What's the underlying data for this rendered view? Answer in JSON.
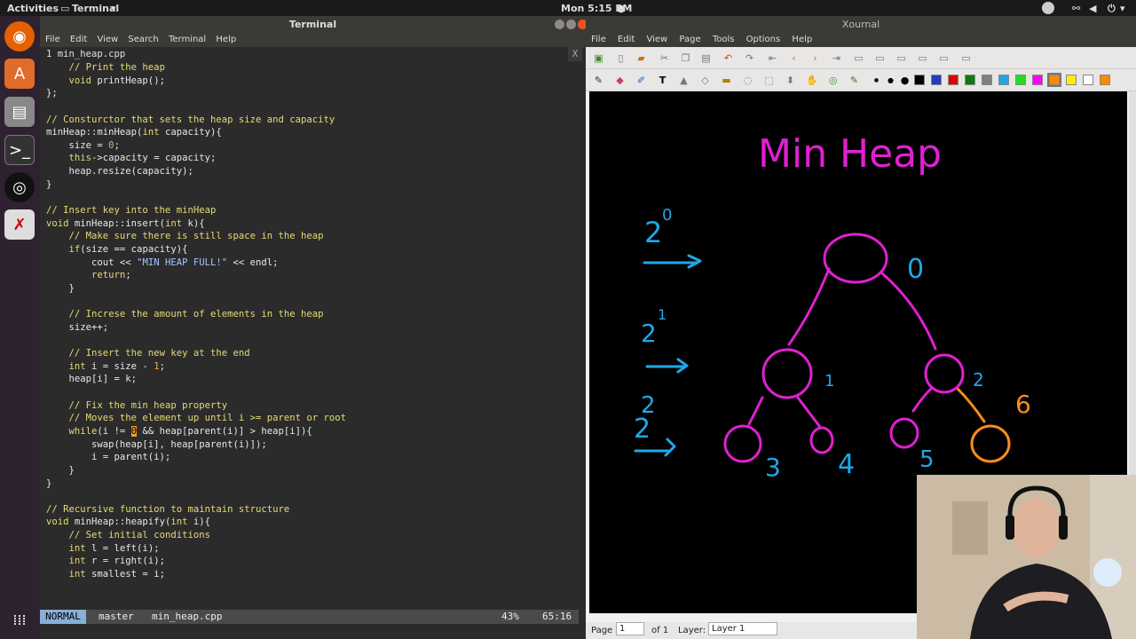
{
  "topbar": {
    "activities": "Activities",
    "app": "Terminal",
    "clock": "Mon  5:15 PM"
  },
  "terminal": {
    "title": "Terminal",
    "menu": [
      "File",
      "Edit",
      "View",
      "Search",
      "Terminal",
      "Help"
    ],
    "tab": "1 min_heap.cpp",
    "tab_close": "X",
    "code": [
      [
        {
          "t": "    "
        },
        {
          "t": "// Print the heap",
          "c": "cm"
        }
      ],
      [
        {
          "t": "    "
        },
        {
          "t": "void",
          "c": "kw"
        },
        {
          "t": " printHeap();"
        }
      ],
      [
        {
          "t": "};"
        }
      ],
      [
        {
          "t": ""
        }
      ],
      [
        {
          "t": "// Consturctor that sets the heap size and capacity",
          "c": "cm"
        }
      ],
      [
        {
          "t": "minHeap::minHeap("
        },
        {
          "t": "int",
          "c": "kw"
        },
        {
          "t": " capacity){"
        }
      ],
      [
        {
          "t": "    size = "
        },
        {
          "t": "0",
          "c": "num"
        },
        {
          "t": ";"
        }
      ],
      [
        {
          "t": "    "
        },
        {
          "t": "this",
          "c": "kw"
        },
        {
          "t": "->capacity = capacity;"
        }
      ],
      [
        {
          "t": "    heap.resize(capacity);"
        }
      ],
      [
        {
          "t": "}"
        }
      ],
      [
        {
          "t": ""
        }
      ],
      [
        {
          "t": "// Insert key into the minHeap",
          "c": "cm"
        }
      ],
      [
        {
          "t": "void",
          "c": "kw"
        },
        {
          "t": " minHeap::insert("
        },
        {
          "t": "int",
          "c": "kw"
        },
        {
          "t": " k){"
        }
      ],
      [
        {
          "t": "    "
        },
        {
          "t": "// Make sure there is still space in the heap",
          "c": "cm"
        }
      ],
      [
        {
          "t": "    "
        },
        {
          "t": "if",
          "c": "kw"
        },
        {
          "t": "(size == capacity){"
        }
      ],
      [
        {
          "t": "        cout << "
        },
        {
          "t": "\"MIN HEAP FULL!\"",
          "c": "str"
        },
        {
          "t": " << endl;"
        }
      ],
      [
        {
          "t": "        "
        },
        {
          "t": "return",
          "c": "kw"
        },
        {
          "t": ";"
        }
      ],
      [
        {
          "t": "    }"
        }
      ],
      [
        {
          "t": ""
        }
      ],
      [
        {
          "t": "    "
        },
        {
          "t": "// Increse the amount of elements in the heap",
          "c": "cm"
        }
      ],
      [
        {
          "t": "    size++;"
        }
      ],
      [
        {
          "t": ""
        }
      ],
      [
        {
          "t": "    "
        },
        {
          "t": "// Insert the new key at the end",
          "c": "cm"
        }
      ],
      [
        {
          "t": "    "
        },
        {
          "t": "int",
          "c": "kw"
        },
        {
          "t": " i = size - "
        },
        {
          "t": "1",
          "c": "num"
        },
        {
          "t": ";"
        }
      ],
      [
        {
          "t": "    heap[i] = k;"
        }
      ],
      [
        {
          "t": ""
        }
      ],
      [
        {
          "t": "    "
        },
        {
          "t": "// Fix the min heap property",
          "c": "cm"
        }
      ],
      [
        {
          "t": "    "
        },
        {
          "t": "// Moves the element up until i >= parent or root",
          "c": "cm"
        }
      ],
      [
        {
          "t": "    "
        },
        {
          "t": "while",
          "c": "kw"
        },
        {
          "t": "(i != "
        },
        {
          "t": "0",
          "c": "cursor"
        },
        {
          "t": " && heap[parent(i)] > heap[i]){"
        }
      ],
      [
        {
          "t": "        swap(heap[i], heap[parent(i)]);"
        }
      ],
      [
        {
          "t": "        i = parent(i);"
        }
      ],
      [
        {
          "t": "    }"
        }
      ],
      [
        {
          "t": "}"
        }
      ],
      [
        {
          "t": ""
        }
      ],
      [
        {
          "t": "// Recursive function to maintain structure",
          "c": "cm"
        }
      ],
      [
        {
          "t": "void",
          "c": "kw"
        },
        {
          "t": " minHeap::heapify("
        },
        {
          "t": "int",
          "c": "kw"
        },
        {
          "t": " i){"
        }
      ],
      [
        {
          "t": "    "
        },
        {
          "t": "// Set initial conditions",
          "c": "cm"
        }
      ],
      [
        {
          "t": "    "
        },
        {
          "t": "int",
          "c": "kw"
        },
        {
          "t": " l = left(i);"
        }
      ],
      [
        {
          "t": "    "
        },
        {
          "t": "int",
          "c": "kw"
        },
        {
          "t": " r = right(i);"
        }
      ],
      [
        {
          "t": "    "
        },
        {
          "t": "int",
          "c": "kw"
        },
        {
          "t": " smallest = i;"
        }
      ]
    ],
    "status": {
      "mode": "NORMAL",
      "branch": "master",
      "file": "min_heap.cpp",
      "percent": "43%",
      "position": "65:16"
    }
  },
  "xournal": {
    "title": "Xournal",
    "menu": [
      "File",
      "Edit",
      "View",
      "Page",
      "Tools",
      "Options",
      "Help"
    ],
    "palette": [
      "#000000",
      "#1f3fbf",
      "#e00000",
      "#117711",
      "#808080",
      "#21a6e0",
      "#22dd22",
      "#ff00ff",
      "#ff8800",
      "#ffee00",
      "#ffffff",
      "#ff8800"
    ],
    "drawing": {
      "title": "Min  Heap",
      "levels": [
        "2",
        "0",
        "2",
        "1",
        "2",
        "2"
      ],
      "node_labels": [
        "0",
        "1",
        "2",
        "3",
        "4",
        "5",
        "6"
      ]
    },
    "status": {
      "page_label": "Page",
      "page_value": "1",
      "of_label": "of 1",
      "layer_label": "Layer:",
      "layer_value": "Layer 1"
    }
  },
  "colors": {
    "magenta": "#e020d0",
    "cyan": "#1ea8e8",
    "orange": "#ff8c1a"
  }
}
